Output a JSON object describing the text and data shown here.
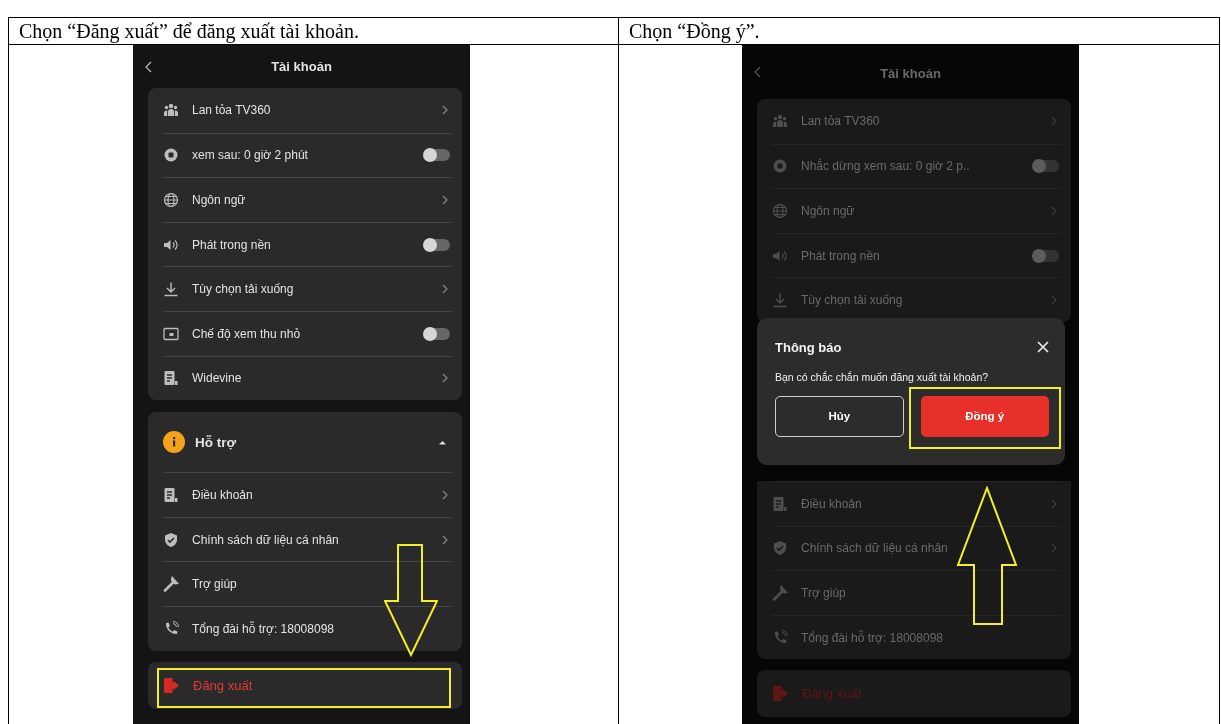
{
  "document": {
    "captions": [
      "Chọn “Đăng xuất” để đăng xuất tài khoản.",
      "Chọn “Đồng ý”."
    ]
  },
  "screens": [
    {
      "title": "Tài khoản",
      "dimmed": false,
      "settings": [
        {
          "label": "Lan tỏa TV360",
          "kind": "link"
        },
        {
          "label": "xem sau: 0 giờ 2 phút",
          "kind": "toggle",
          "on": false
        },
        {
          "label": "Ngôn ngữ",
          "kind": "link"
        },
        {
          "label": "Phát trong nền",
          "kind": "toggle",
          "on": false
        },
        {
          "label": "Tùy chọn tải xuống",
          "kind": "link"
        },
        {
          "label": "Chế độ xem thu nhỏ",
          "kind": "toggle",
          "on": false
        },
        {
          "label": "Widevine",
          "kind": "link"
        }
      ],
      "support": {
        "title": "Hỗ trợ",
        "expanded": true,
        "items": [
          {
            "label": "Điều khoản",
            "kind": "link"
          },
          {
            "label": "Chính sách dữ liệu cá nhân",
            "kind": "link"
          },
          {
            "label": "Trợ giúp",
            "kind": "plain"
          },
          {
            "label": "Tổng đài hỗ trợ: 18008098",
            "kind": "plain"
          }
        ]
      },
      "logout": {
        "label": "Đăng xuất",
        "highlighted": true
      },
      "arrow_up": false
    },
    {
      "title": "Tài khoản",
      "dimmed": true,
      "settings": [
        {
          "label": "Lan tỏa TV360",
          "kind": "link"
        },
        {
          "label": "Nhắc dừng xem sau: 0 giờ 2 p..",
          "kind": "toggle",
          "on": false
        },
        {
          "label": "Ngôn ngữ",
          "kind": "link"
        },
        {
          "label": "Phát trong nền",
          "kind": "toggle",
          "on": false
        },
        {
          "label": "Tùy chọn tải xuống",
          "kind": "link"
        }
      ],
      "dialog": {
        "title": "Thông báo",
        "message": "Bạn có chắc chắn muốn đăng xuất tài khoản?",
        "buttons": [
          {
            "label": "Hủy",
            "kind": "secondary",
            "highlighted": false
          },
          {
            "label": "Đồng ý",
            "kind": "primary",
            "highlighted": true
          }
        ]
      },
      "support": {
        "items": [
          {
            "label": "Điều khoản",
            "kind": "link"
          },
          {
            "label": "Chính sách dữ liệu cá nhân",
            "kind": "link"
          },
          {
            "label": "Trợ giúp",
            "kind": "plain"
          },
          {
            "label": "Tổng đài hỗ trợ: 18008098",
            "kind": "plain"
          }
        ]
      },
      "logout": {
        "label": "Đăng xuất",
        "highlighted": false
      },
      "arrow_up": true
    }
  ]
}
